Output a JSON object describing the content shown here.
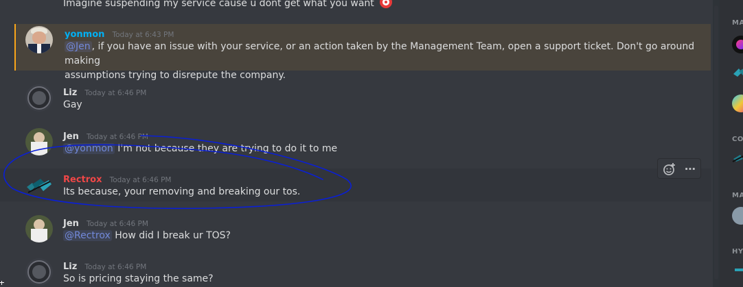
{
  "messages": [
    {
      "username": "",
      "timestamp": "",
      "text": "Imagine suspending my service cause u dont get what you want",
      "emoji": "target"
    },
    {
      "username": "yonmon",
      "username_color": "#00b0f4",
      "timestamp": "Today at 6:43 PM",
      "mention": "@Jen",
      "text_line1": ", if you have an issue with your service, or an action taken by the Management Team, open a support ticket. Don't go around making",
      "text_line2": "assumptions trying to disrepute the company."
    },
    {
      "username": "Liz",
      "username_color": "#dcddde",
      "timestamp": "Today at 6:46 PM",
      "text": "Gay"
    },
    {
      "username": "Jen",
      "username_color": "#dcddde",
      "timestamp": "Today at 6:46 PM",
      "mention": "@yonmon",
      "text": " I'm not because they are trying to do it to me"
    },
    {
      "username": "Rectrox",
      "username_color": "#f04747",
      "timestamp": "Today at 6:46 PM",
      "text": "Its because, your removing and breaking our tos."
    },
    {
      "username": "Jen",
      "username_color": "#dcddde",
      "timestamp": "Today at 6:46 PM",
      "mention": "@Rectrox",
      "text": " How did I break ur TOS?"
    },
    {
      "username": "Liz",
      "username_color": "#dcddde",
      "timestamp": "Today at 6:46 PM",
      "text": "So is pricing staying the same?"
    }
  ],
  "members": {
    "sections": [
      "MA",
      "CO",
      "MA",
      "HY"
    ]
  },
  "toolbar": {
    "add_reaction_icon": "add-reaction-icon",
    "more_icon": "more-icon",
    "more_label": "⋯"
  },
  "colors": {
    "background": "#36393f",
    "mention": "#7289da",
    "highlight_border": "#faa61a",
    "annotation_stroke": "#0a1fd6"
  }
}
